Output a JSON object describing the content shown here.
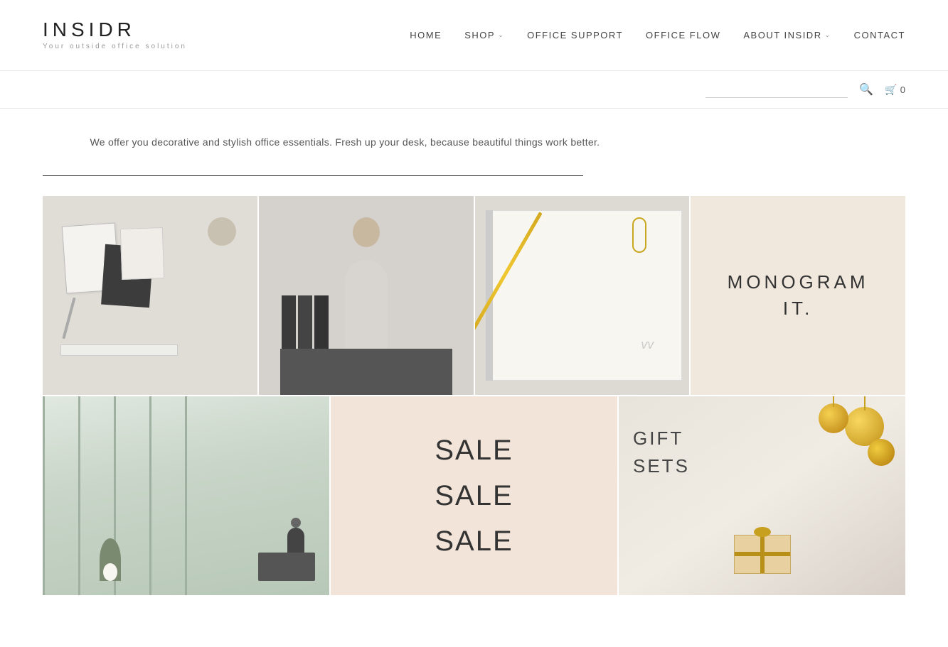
{
  "header": {
    "logo": {
      "text": "INSIDR",
      "tagline": "Your outside office solution"
    },
    "nav": {
      "items": [
        {
          "label": "HOME",
          "hasDropdown": false
        },
        {
          "label": "SHOP",
          "hasDropdown": true
        },
        {
          "label": "OFFICE SUPPORT",
          "hasDropdown": false
        },
        {
          "label": "OFFICE FLOW",
          "hasDropdown": false
        },
        {
          "label": "ABOUT INSIDR",
          "hasDropdown": true
        },
        {
          "label": "CONTACT",
          "hasDropdown": false
        }
      ]
    }
  },
  "search_bar": {
    "placeholder": "",
    "cart_count": "0"
  },
  "hero": {
    "description": "We offer you decorative and stylish office essentials. Fresh up your desk, because beautiful things work better."
  },
  "grid_row1": [
    {
      "type": "image",
      "alt": "Office supplies — notebooks, ruler, pen on white desk",
      "img_class": "fake-img-office-supplies"
    },
    {
      "type": "image",
      "alt": "Woman sitting on cabinet looking through binders",
      "img_class": "fake-img-woman"
    },
    {
      "type": "image",
      "alt": "Spiral notebook with gold pen and paper clip",
      "img_class": "fake-img-notebook"
    },
    {
      "type": "text",
      "label": "MONOGRAM\nIT.",
      "bg_class": "text-cell-beige"
    }
  ],
  "grid_row2": [
    {
      "type": "image",
      "alt": "Modern bright office interior with plants",
      "img_class": "fake-img-interior"
    },
    {
      "type": "text",
      "label": "SALE\nSALE\nSALE",
      "bg_class": "text-cell-peach",
      "style": "sale"
    },
    {
      "type": "image",
      "alt": "Gift sets with gold ornaments and wrapped presents",
      "img_class": "fake-img-gift"
    }
  ],
  "colors": {
    "beige_bg": "#f0e8dd",
    "peach_bg": "#f2e4d8",
    "text_dark": "#333333",
    "nav_text": "#444444"
  }
}
